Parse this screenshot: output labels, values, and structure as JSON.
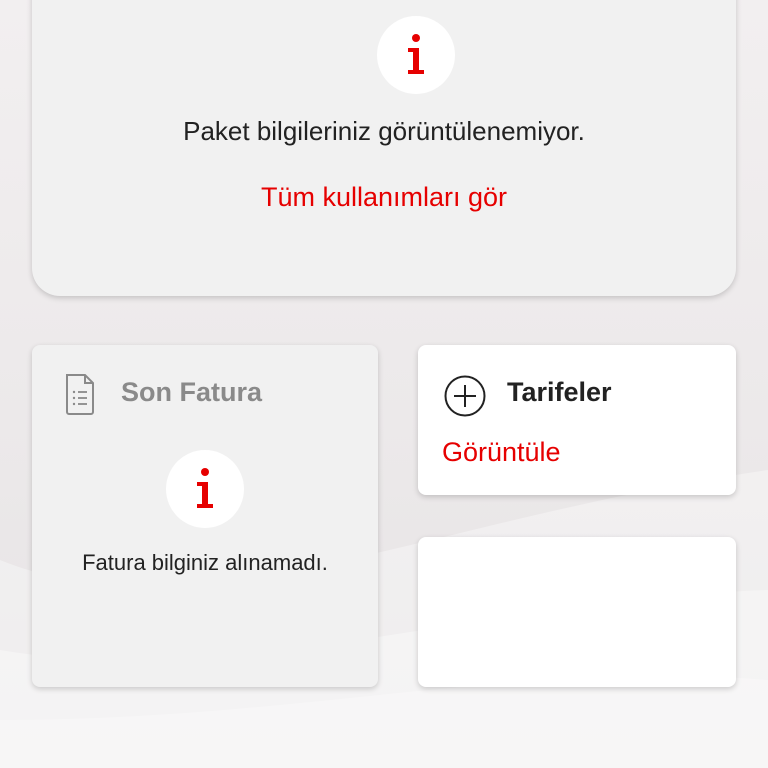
{
  "package_card": {
    "info_icon": "info-icon",
    "message": "Paket bilgileriniz görüntülenemiyor.",
    "link": "Tüm kullanımları gör"
  },
  "invoice_card": {
    "icon": "document-icon",
    "title": "Son Fatura",
    "info_icon": "info-icon",
    "message": "Fatura bilginiz alınamadı."
  },
  "tariff_card": {
    "icon": "plus-circle-icon",
    "title": "Tarifeler",
    "link": "Görüntüle"
  },
  "colors": {
    "accent_red": "#e60000",
    "text_dark": "#222222",
    "text_muted": "#8a8a8a",
    "card_grey": "#f1f1f1",
    "card_white": "#ffffff"
  }
}
